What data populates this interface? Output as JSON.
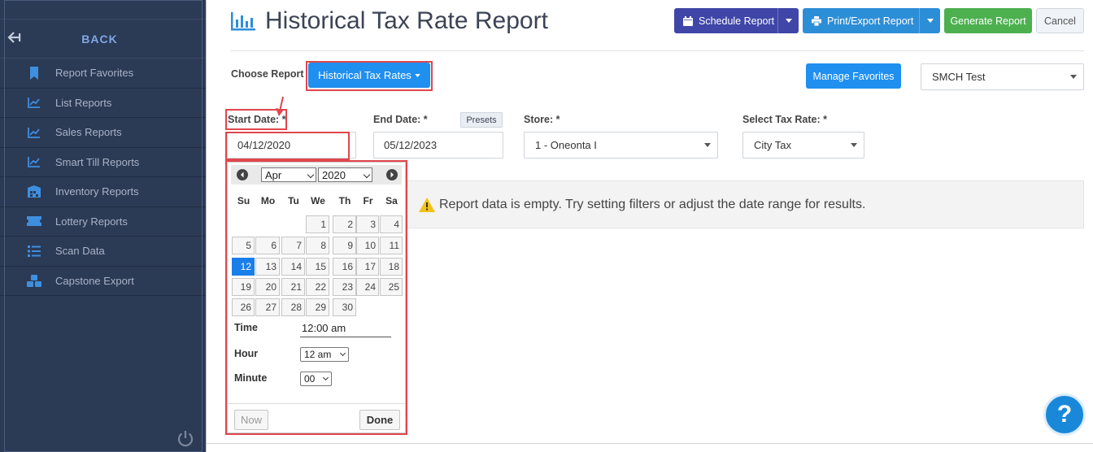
{
  "sidebar": {
    "back_label": "BACK",
    "items": [
      {
        "label": "Report Favorites",
        "icon": "bookmark-icon"
      },
      {
        "label": "List Reports",
        "icon": "line-chart-icon"
      },
      {
        "label": "Sales Reports",
        "icon": "line-chart-icon"
      },
      {
        "label": "Smart Till Reports",
        "icon": "line-chart-icon"
      },
      {
        "label": "Inventory Reports",
        "icon": "warehouse-icon"
      },
      {
        "label": "Lottery Reports",
        "icon": "ticket-icon"
      },
      {
        "label": "Scan Data",
        "icon": "list-icon"
      },
      {
        "label": "Capstone Export",
        "icon": "cubes-icon"
      }
    ]
  },
  "header": {
    "title": "Historical Tax Rate Report",
    "schedule_label": "Schedule Report",
    "print_label": "Print/Export Report",
    "generate_label": "Generate Report",
    "cancel_label": "Cancel"
  },
  "report_picker": {
    "label": "Choose Report",
    "selected": "Historical Tax Rates",
    "manage_favorites_label": "Manage Favorites",
    "store_group": "SMCH Test"
  },
  "filters": {
    "start_date_label": "Start Date: *",
    "start_date_value": "04/12/2020",
    "end_date_label": "End Date: *",
    "end_date_value": "05/12/2023",
    "presets_label": "Presets",
    "store_label": "Store: *",
    "store_value": "1 - Oneonta I",
    "tax_rate_label": "Select Tax Rate: *",
    "tax_rate_value": "City Tax"
  },
  "empty_message": "Report data is empty. Try setting filters or adjust the date range for results.",
  "calendar": {
    "month": "Apr",
    "year": "2020",
    "weekdays": [
      "Su",
      "Mo",
      "Tu",
      "We",
      "Th",
      "Fr",
      "Sa"
    ],
    "first_weekday": 3,
    "days_in_month": 30,
    "selected_day": 12,
    "time_label": "Time",
    "time_value": "12:00 am",
    "hour_label": "Hour",
    "hour_value": "12 am",
    "minute_label": "Minute",
    "minute_value": "00",
    "now_label": "Now",
    "done_label": "Done"
  },
  "help_label": "?",
  "colors": {
    "sidebar_bg": "#2b3a55",
    "primary": "#1f8ff0",
    "schedule": "#3f46a8",
    "generate": "#4cb04f",
    "highlight": "#e0464d"
  }
}
